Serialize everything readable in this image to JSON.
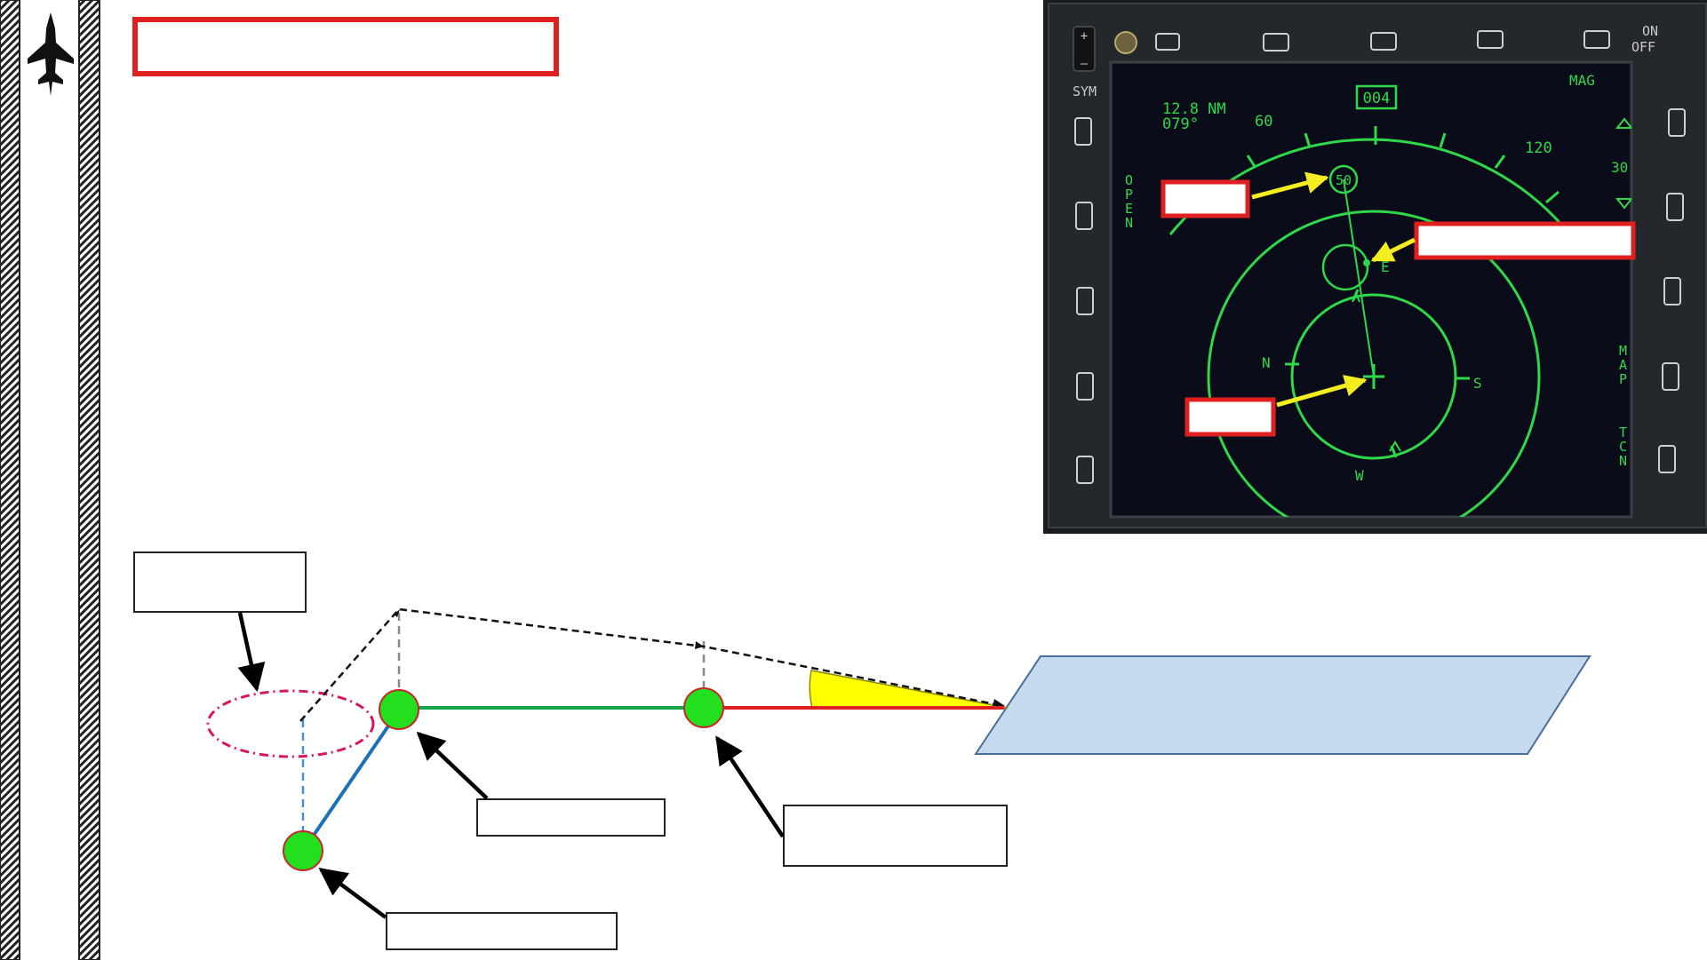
{
  "title_box": "",
  "diagram": {
    "label_boxes": [
      "",
      "",
      "",
      ""
    ]
  },
  "mfd": {
    "header": "MAG",
    "range_nm": "12.8 NM",
    "bearing": "079°",
    "heading_box": "004",
    "heading_ticks": {
      "left": "60",
      "right": "120"
    },
    "range_scale": "30",
    "compass": {
      "n": "N",
      "e": "E",
      "s": "S",
      "w": "W"
    },
    "waypoint_symbol": "50",
    "side_labels": {
      "sym": "SYM",
      "open": "OPEN",
      "map": "MAP",
      "tcn": "TCN",
      "on": "ON",
      "off": "OFF"
    },
    "callouts": [
      "",
      "",
      ""
    ]
  },
  "colors": {
    "accent_red": "#e02020",
    "route_green": "#19a34a",
    "route_blue": "#1d6fb8",
    "route_red": "#e02020",
    "waypoint_fill": "#22e01e",
    "mfd_symbology": "#2fd84a",
    "runway_fill": "#c5d9ef",
    "glide_wedge": "#ffff00"
  }
}
